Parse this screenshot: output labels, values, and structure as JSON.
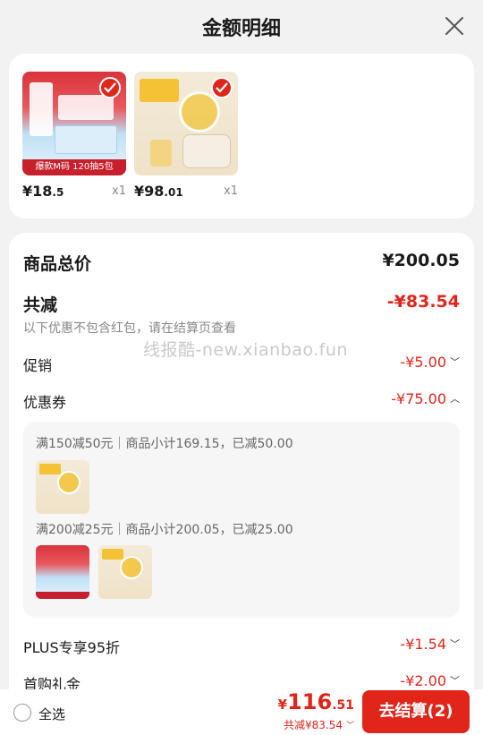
{
  "header": {
    "title": "金额明细"
  },
  "products": [
    {
      "thumb_caption": "爆款M码 120抽5包",
      "price_int": "¥18",
      "price_dec": ".5",
      "qty": "x1"
    },
    {
      "thumb_caption": "",
      "price_int": "¥98",
      "price_dec": ".01",
      "qty": "x1"
    }
  ],
  "summary": {
    "total_label": "商品总价",
    "total_value": "¥200.05",
    "discount_label": "共减",
    "discount_value": "-¥83.54",
    "note": "以下优惠不包含红包，请在结算页查看",
    "watermark": "线报酷-new.xianbao.fun",
    "promo_label": "促销",
    "promo_value": "-¥5.00",
    "coupon_label": "优惠券",
    "coupon_value": "-¥75.00",
    "coupon_lines": [
      "满150减50元｜商品小计169.15，已减50.00",
      "满200减25元｜商品小计200.05，已减25.00"
    ],
    "plus_label": "PLUS专享95折",
    "plus_value": "-¥1.54",
    "gift_label": "首购礼金",
    "gift_value": "-¥2.00"
  },
  "footer": {
    "select_all": "全选",
    "total_yen": "¥",
    "total_int": "116",
    "total_dec": ".51",
    "saved": "共减¥83.54",
    "checkout_label": "去结算(2)"
  },
  "colors": {
    "accent": "#e1251b",
    "bg": "#f2f2f2"
  }
}
